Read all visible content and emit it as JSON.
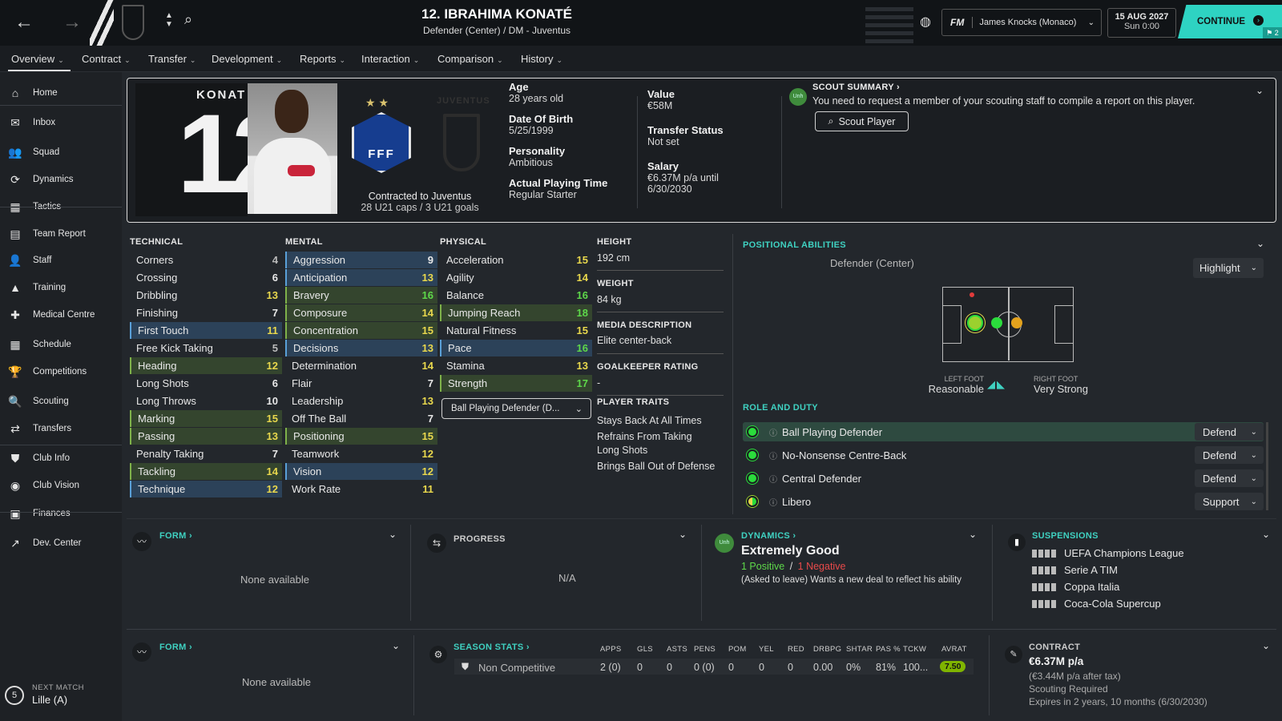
{
  "header": {
    "title": "12. IBRAHIMA KONATÉ",
    "subtitle": "Defender (Center) / DM - Juventus",
    "manager": "James Knocks (Monaco)",
    "date": "15 AUG 2027",
    "time": "Sun 0:00",
    "continue_label": "CONTINUE",
    "fm_label": "FM",
    "notif_count": "2"
  },
  "nav": [
    "Overview",
    "Contract",
    "Transfer",
    "Development",
    "Reports",
    "Interaction",
    "Comparison",
    "History"
  ],
  "sidebar": [
    {
      "label": "Home",
      "icon": "home-icon",
      "glyph": "⌂"
    },
    {
      "label": "Inbox",
      "icon": "inbox-icon",
      "glyph": "✉"
    },
    {
      "label": "Squad",
      "icon": "squad-icon",
      "glyph": "👥"
    },
    {
      "label": "Dynamics",
      "icon": "dynamics-icon",
      "glyph": "⟳"
    },
    {
      "label": "Tactics",
      "icon": "tactics-icon",
      "glyph": "▦"
    },
    {
      "label": "Team Report",
      "icon": "report-icon",
      "glyph": "▤"
    },
    {
      "label": "Staff",
      "icon": "staff-icon",
      "glyph": "👤"
    },
    {
      "label": "Training",
      "icon": "training-icon",
      "glyph": "▲"
    },
    {
      "label": "Medical Centre",
      "icon": "medical-icon",
      "glyph": "✚"
    },
    {
      "label": "Schedule",
      "icon": "schedule-icon",
      "glyph": "▦"
    },
    {
      "label": "Competitions",
      "icon": "trophy-icon",
      "glyph": "🏆"
    },
    {
      "label": "Scouting",
      "icon": "scouting-icon",
      "glyph": "🔍"
    },
    {
      "label": "Transfers",
      "icon": "transfers-icon",
      "glyph": "⇄"
    },
    {
      "label": "Club Info",
      "icon": "shield-icon",
      "glyph": "⛊"
    },
    {
      "label": "Club Vision",
      "icon": "vision-icon",
      "glyph": "◉"
    },
    {
      "label": "Finances",
      "icon": "finances-icon",
      "glyph": "▣"
    },
    {
      "label": "Dev. Center",
      "icon": "dev-center-icon",
      "glyph": "↗"
    }
  ],
  "next_match": {
    "label": "NEXT MATCH",
    "value": "Lille (A)",
    "badge": "5"
  },
  "player": {
    "surname_banner": "KONAT",
    "number": "12",
    "stars": "★ ★",
    "federation": "FFF",
    "club_wordmark": "JUVENTUS",
    "contracted": "Contracted to Juventus",
    "caps": "28 U21 caps / 3 U21 goals"
  },
  "bio": {
    "age_label": "Age",
    "age": "28 years old",
    "dob_label": "Date Of Birth",
    "dob": "5/25/1999",
    "personality_label": "Personality",
    "personality": "Ambitious",
    "apt_label": "Actual Playing Time",
    "apt": "Regular Starter",
    "value_label": "Value",
    "value": "€58M",
    "status_label": "Transfer Status",
    "status": "Not set",
    "salary_label": "Salary",
    "salary": "€6.37M p/a until",
    "salary_until": "6/30/2030"
  },
  "scout": {
    "title": "SCOUT SUMMARY",
    "text": "You need to request a member of your scouting staff to compile a report on this player.",
    "button": "Scout Player",
    "badge": "Unh"
  },
  "attributes": {
    "technical_title": "TECHNICAL",
    "mental_title": "MENTAL",
    "physical_title": "PHYSICAL",
    "technical": [
      {
        "name": "Corners",
        "value": "4",
        "hl": "",
        "c": "c-grey"
      },
      {
        "name": "Crossing",
        "value": "6",
        "hl": "",
        "c": "c-white"
      },
      {
        "name": "Dribbling",
        "value": "13",
        "hl": "",
        "c": "c-yel"
      },
      {
        "name": "Finishing",
        "value": "7",
        "hl": "",
        "c": "c-white"
      },
      {
        "name": "First Touch",
        "value": "11",
        "hl": "hl-b",
        "c": "c-yel"
      },
      {
        "name": "Free Kick Taking",
        "value": "5",
        "hl": "",
        "c": "c-grey"
      },
      {
        "name": "Heading",
        "value": "12",
        "hl": "hl-g",
        "c": "c-yel"
      },
      {
        "name": "Long Shots",
        "value": "6",
        "hl": "",
        "c": "c-white"
      },
      {
        "name": "Long Throws",
        "value": "10",
        "hl": "",
        "c": "c-white"
      },
      {
        "name": "Marking",
        "value": "15",
        "hl": "hl-g",
        "c": "c-yel"
      },
      {
        "name": "Passing",
        "value": "13",
        "hl": "hl-g",
        "c": "c-yel"
      },
      {
        "name": "Penalty Taking",
        "value": "7",
        "hl": "",
        "c": "c-white"
      },
      {
        "name": "Tackling",
        "value": "14",
        "hl": "hl-g",
        "c": "c-yel"
      },
      {
        "name": "Technique",
        "value": "12",
        "hl": "hl-b",
        "c": "c-yel"
      }
    ],
    "mental": [
      {
        "name": "Aggression",
        "value": "9",
        "hl": "hl-b",
        "c": "c-white"
      },
      {
        "name": "Anticipation",
        "value": "13",
        "hl": "hl-b",
        "c": "c-yel"
      },
      {
        "name": "Bravery",
        "value": "16",
        "hl": "hl-g",
        "c": "c-grn"
      },
      {
        "name": "Composure",
        "value": "14",
        "hl": "hl-g",
        "c": "c-yel"
      },
      {
        "name": "Concentration",
        "value": "15",
        "hl": "hl-g",
        "c": "c-yel"
      },
      {
        "name": "Decisions",
        "value": "13",
        "hl": "hl-b",
        "c": "c-yel"
      },
      {
        "name": "Determination",
        "value": "14",
        "hl": "",
        "c": "c-yel"
      },
      {
        "name": "Flair",
        "value": "7",
        "hl": "",
        "c": "c-white"
      },
      {
        "name": "Leadership",
        "value": "13",
        "hl": "",
        "c": "c-yel"
      },
      {
        "name": "Off The Ball",
        "value": "7",
        "hl": "",
        "c": "c-white"
      },
      {
        "name": "Positioning",
        "value": "15",
        "hl": "hl-g",
        "c": "c-yel"
      },
      {
        "name": "Teamwork",
        "value": "12",
        "hl": "",
        "c": "c-yel"
      },
      {
        "name": "Vision",
        "value": "12",
        "hl": "hl-b",
        "c": "c-yel"
      },
      {
        "name": "Work Rate",
        "value": "11",
        "hl": "",
        "c": "c-yel"
      }
    ],
    "physical": [
      {
        "name": "Acceleration",
        "value": "15",
        "hl": "",
        "c": "c-yel"
      },
      {
        "name": "Agility",
        "value": "14",
        "hl": "",
        "c": "c-yel"
      },
      {
        "name": "Balance",
        "value": "16",
        "hl": "",
        "c": "c-grn"
      },
      {
        "name": "Jumping Reach",
        "value": "18",
        "hl": "hl-g",
        "c": "c-grn"
      },
      {
        "name": "Natural Fitness",
        "value": "15",
        "hl": "",
        "c": "c-yel"
      },
      {
        "name": "Pace",
        "value": "16",
        "hl": "hl-b",
        "c": "c-grn"
      },
      {
        "name": "Stamina",
        "value": "13",
        "hl": "",
        "c": "c-yel"
      },
      {
        "name": "Strength",
        "value": "17",
        "hl": "hl-g",
        "c": "c-grn"
      }
    ],
    "role_select": "Ball Playing Defender (D..."
  },
  "info": {
    "height_label": "HEIGHT",
    "height": "192 cm",
    "weight_label": "WEIGHT",
    "weight": "84 kg",
    "media_label": "MEDIA DESCRIPTION",
    "media": "Elite center-back",
    "gk_label": "GOALKEEPER RATING",
    "gk": "-",
    "traits_label": "PLAYER TRAITS",
    "traits": [
      "Stays Back At All Times",
      "Refrains From Taking",
      "Long Shots",
      "Brings Ball Out of Defense"
    ]
  },
  "positional": {
    "title": "POSITIONAL ABILITIES",
    "position": "Defender (Center)",
    "highlight": "Highlight",
    "left_foot_label": "LEFT FOOT",
    "left_foot": "Reasonable",
    "right_foot_label": "RIGHT FOOT",
    "right_foot": "Very Strong"
  },
  "roles": {
    "title": "ROLE AND DUTY",
    "items": [
      {
        "name": "Ball Playing Defender",
        "duty": "Defend"
      },
      {
        "name": "No-Nonsense Centre-Back",
        "duty": "Defend"
      },
      {
        "name": "Central Defender",
        "duty": "Defend"
      },
      {
        "name": "Libero",
        "duty": "Support"
      }
    ]
  },
  "form1": {
    "title": "FORM",
    "empty": "None available"
  },
  "progress": {
    "title": "PROGRESS",
    "empty": "N/A"
  },
  "dynamics": {
    "title": "DYNAMICS",
    "status": "Extremely Good",
    "positive": "1 Positive",
    "sep": "/",
    "negative": "1 Negative",
    "note": "(Asked to leave) Wants a new deal to reflect his ability",
    "badge": "Unh"
  },
  "suspensions": {
    "title": "SUSPENSIONS",
    "items": [
      "UEFA Champions League",
      "Serie A TIM",
      "Coppa Italia",
      "Coca-Cola Supercup"
    ]
  },
  "form2": {
    "title": "FORM",
    "empty": "None available"
  },
  "season": {
    "title": "SEASON STATS",
    "row_label": "Non Competitive",
    "headers": [
      "APPS",
      "GLS",
      "ASTS",
      "PENS",
      "POM",
      "YEL",
      "RED",
      "DRBPG",
      "SHTAR",
      "PAS %",
      "TCKW",
      "AVRAT"
    ],
    "values": [
      "2 (0)",
      "0",
      "0",
      "0 (0)",
      "0",
      "0",
      "0",
      "0.00",
      "0%",
      "81%",
      "100...",
      "7.50"
    ]
  },
  "contract": {
    "title": "CONTRACT",
    "wage": "€6.37M p/a",
    "after_tax": "(€3.44M p/a after tax)",
    "scouting": "Scouting Required",
    "expires": "Expires in 2 years, 10 months (6/30/2030)"
  },
  "colors": {
    "accent": "#3fd1c1",
    "continue": "#2ed3c2",
    "green": "#2bdc3c",
    "rating": "#7fb400"
  }
}
